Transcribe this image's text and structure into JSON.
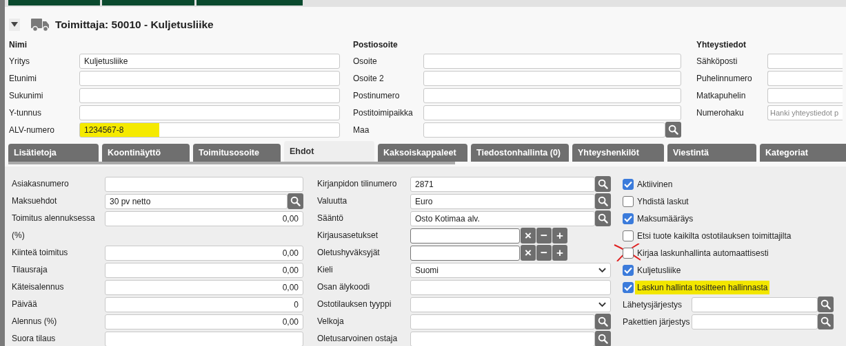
{
  "header": {
    "title": "Toimittaja: 50010 - Kuljetusliike",
    "expanded": true
  },
  "sections": [
    {
      "heading": "Nimi",
      "fields": [
        {
          "label": "Yritys",
          "kind": "text",
          "value": "Kuljetusliike"
        },
        {
          "label": "Etunimi",
          "kind": "text"
        },
        {
          "label": "Sukunimi",
          "kind": "text"
        },
        {
          "label": "Y-tunnus",
          "kind": "text"
        },
        {
          "label": "ALV-numero",
          "kind": "text",
          "value": "1234567-8",
          "highlighted": true
        }
      ]
    },
    {
      "heading": "Postiosoite",
      "fields": [
        {
          "label": "Osoite",
          "kind": "text"
        },
        {
          "label": "Osoite 2",
          "kind": "text"
        },
        {
          "label": "Postinumero",
          "kind": "text"
        },
        {
          "label": "Postitoimipaikka",
          "kind": "text"
        },
        {
          "label": "Maa",
          "kind": "search"
        }
      ]
    },
    {
      "heading": "Yhteystiedot",
      "fields": [
        {
          "label": "Sähköposti",
          "kind": "text"
        },
        {
          "label": "Puhelinnumero",
          "kind": "text"
        },
        {
          "label": "Matkapuhelin",
          "kind": "text"
        },
        {
          "label": "Numerohaku",
          "kind": "text",
          "placeholder": "Hanki yhteystiedot p"
        }
      ]
    }
  ],
  "tabs": [
    {
      "label": "Lisätietoja",
      "selected": false
    },
    {
      "label": "Koontinäyttö",
      "selected": false
    },
    {
      "label": "Toimitusosoite",
      "selected": false
    },
    {
      "label": "Ehdot",
      "selected": true
    },
    {
      "label": "Kaksoiskappaleet",
      "selected": false
    },
    {
      "label": "Tiedostonhallinta (0)",
      "selected": false
    },
    {
      "label": "Yhteyshenkilöt",
      "selected": false
    },
    {
      "label": "Viestintä",
      "selected": false
    },
    {
      "label": "Kategoriat",
      "selected": false
    }
  ],
  "terms_left": [
    {
      "label": "Asiakasnumero",
      "kind": "text"
    },
    {
      "label": "Maksuehdot",
      "kind": "search",
      "value": "30 pv netto"
    },
    {
      "label": "Toimitus alennuksessa (%)",
      "kind": "number",
      "value": "0,00"
    },
    {
      "label": "Kiinteä toimitus",
      "kind": "number",
      "value": "0,00"
    },
    {
      "label": "Tilausraja",
      "kind": "number",
      "value": "0,00"
    },
    {
      "label": "Käteisalennus",
      "kind": "number",
      "value": "0,00"
    },
    {
      "label": "Päivää",
      "kind": "number",
      "value": "0"
    },
    {
      "label": "Alennus (%)",
      "kind": "number",
      "value": "0,00"
    },
    {
      "label": "Suora tilaus",
      "kind": "text"
    }
  ],
  "terms_middle": [
    {
      "label": "Kirjanpidon tilinumero",
      "kind": "search",
      "value": "2871"
    },
    {
      "label": "Valuutta",
      "kind": "search",
      "value": "Euro"
    },
    {
      "label": "Sääntö",
      "kind": "search",
      "value": "Osto Kotimaa alv."
    },
    {
      "label": "Kirjausasetukset",
      "kind": "multi",
      "buttons": [
        "×",
        "−",
        "+"
      ]
    },
    {
      "label": "Oletushyväksyjät",
      "kind": "multi",
      "buttons": [
        "×",
        "−",
        "+"
      ]
    },
    {
      "label": "Kieli",
      "kind": "select",
      "value": "Suomi"
    },
    {
      "label": "Osan älykoodi",
      "kind": "text"
    },
    {
      "label": "Ostotilauksen tyyppi",
      "kind": "select"
    },
    {
      "label": "Velkoja",
      "kind": "search"
    },
    {
      "label": "Oletusarvoinen ostaja",
      "kind": "search"
    }
  ],
  "checkboxes": [
    {
      "label": "Aktiivinen",
      "checked": true
    },
    {
      "label": "Yhdistä laskut",
      "checked": false
    },
    {
      "label": "Maksumääräys",
      "checked": true
    },
    {
      "label": "Etsi tuote kaikilta ostotilauksen toimittajilta",
      "checked": false
    },
    {
      "label": "Kirjaa laskunhallinta automaattisesti",
      "checked": false,
      "crossed_out": true
    },
    {
      "label": "Kuljetusliike",
      "checked": true
    },
    {
      "label": "Laskun hallinta tositteen hallinnasta",
      "checked": true,
      "highlighted": true
    }
  ],
  "terms_right": [
    {
      "label": "Lähetysjärjestys",
      "kind": "search"
    },
    {
      "label": "Pakettien järjestys",
      "kind": "search"
    }
  ]
}
